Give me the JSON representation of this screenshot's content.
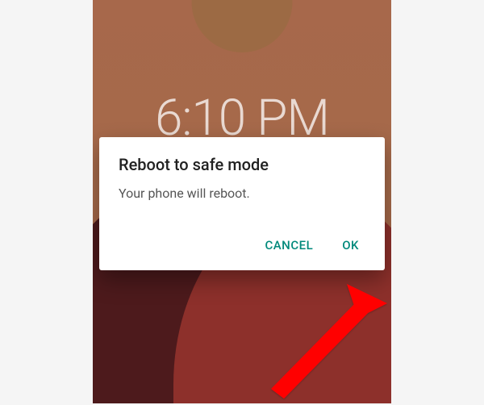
{
  "lockscreen": {
    "time": "6:10 PM"
  },
  "dialog": {
    "title": "Reboot to safe mode",
    "message": "Your phone will reboot.",
    "cancel_label": "CANCEL",
    "ok_label": "OK"
  }
}
